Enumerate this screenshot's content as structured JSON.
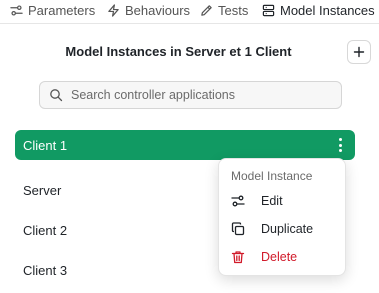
{
  "tabs": [
    {
      "label": "Parameters",
      "icon": "sliders-icon"
    },
    {
      "label": "Behaviours",
      "icon": "bolt-icon"
    },
    {
      "label": "Tests",
      "icon": "pencil-icon"
    },
    {
      "label": "Model Instances",
      "icon": "server-icon",
      "active": true
    }
  ],
  "header": {
    "title": "Model Instances in Server et 1 Client",
    "add_icon": "plus-icon"
  },
  "search": {
    "placeholder": "Search controller applications",
    "value": ""
  },
  "instances": [
    {
      "label": "Client 1",
      "selected": true
    },
    {
      "label": "Server"
    },
    {
      "label": "Client 2"
    },
    {
      "label": "Client 3"
    }
  ],
  "context_menu": {
    "header": "Model Instance",
    "items": [
      {
        "label": "Edit",
        "icon": "sliders-icon"
      },
      {
        "label": "Duplicate",
        "icon": "copy-icon"
      },
      {
        "label": "Delete",
        "icon": "trash-icon",
        "danger": true
      }
    ]
  },
  "colors": {
    "selected_bg": "#119a63",
    "danger": "#d11a2a"
  }
}
